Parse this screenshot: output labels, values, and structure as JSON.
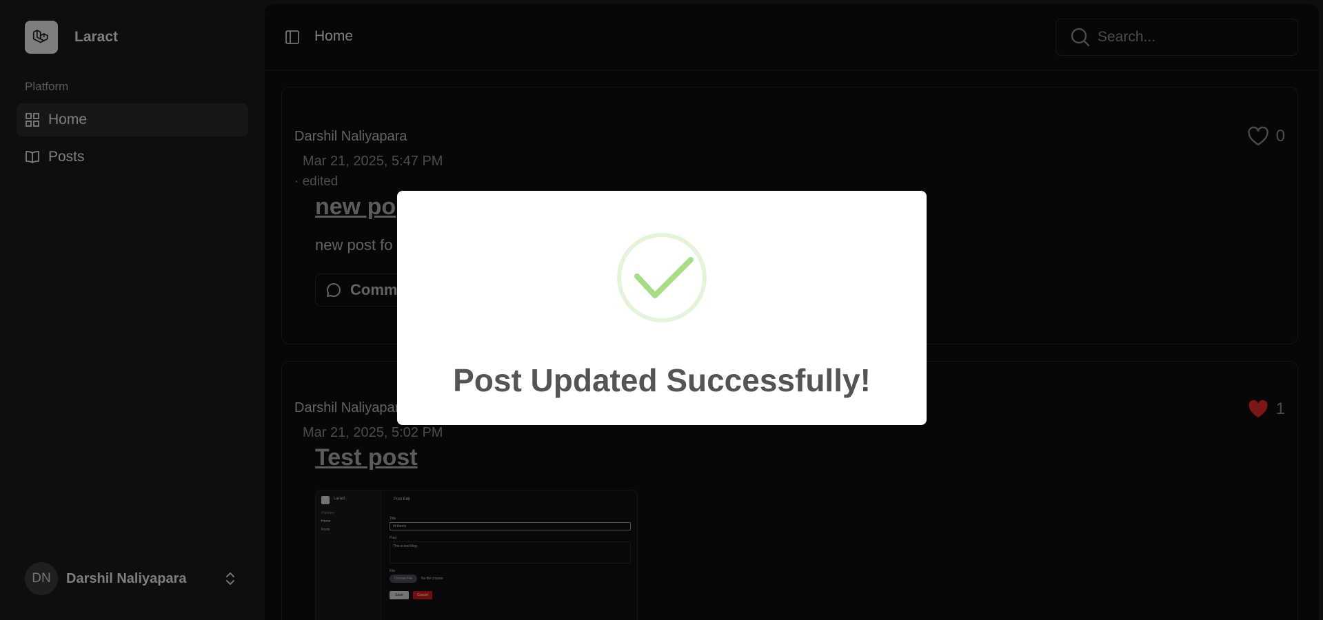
{
  "sidebar": {
    "brand": "Laract",
    "group_label": "Platform",
    "items": [
      {
        "label": "Home",
        "icon": "grid-icon"
      },
      {
        "label": "Posts",
        "icon": "book-open-icon"
      }
    ],
    "user": {
      "initials": "DN",
      "name": "Darshil Naliyapara"
    }
  },
  "header": {
    "breadcrumb": "Home",
    "search_placeholder": "Search..."
  },
  "posts": [
    {
      "author": "Darshil Naliyapara",
      "date": "Mar 21, 2025, 5:47 PM",
      "edited": "· edited",
      "title": "new po",
      "body": "new post fo",
      "comment_label": "Comm",
      "likes": "0",
      "liked": false
    },
    {
      "author": "Darshil Naliyapar",
      "date": "Mar 21, 2025, 5:02 PM",
      "title": "Test post",
      "likes": "1",
      "liked": true,
      "thumbnail": {
        "brand": "Laract",
        "group": "Platform",
        "items": [
          "Home",
          "Posts"
        ],
        "header": "Post Edit",
        "title_label": "Title",
        "title_value": "t4 theme",
        "post_label": "Post",
        "post_value": "This is test blog",
        "file_label": "File",
        "choose_file": "Choose File",
        "no_file": "No file chosen",
        "save": "Save",
        "cancel": "Cancel"
      }
    }
  ],
  "modal": {
    "title": "Post Updated Successfully!",
    "icon": "success-check-icon"
  },
  "colors": {
    "success": "#a5dc86",
    "like_red": "#e0282e",
    "cancel_red": "#c81e1e"
  }
}
